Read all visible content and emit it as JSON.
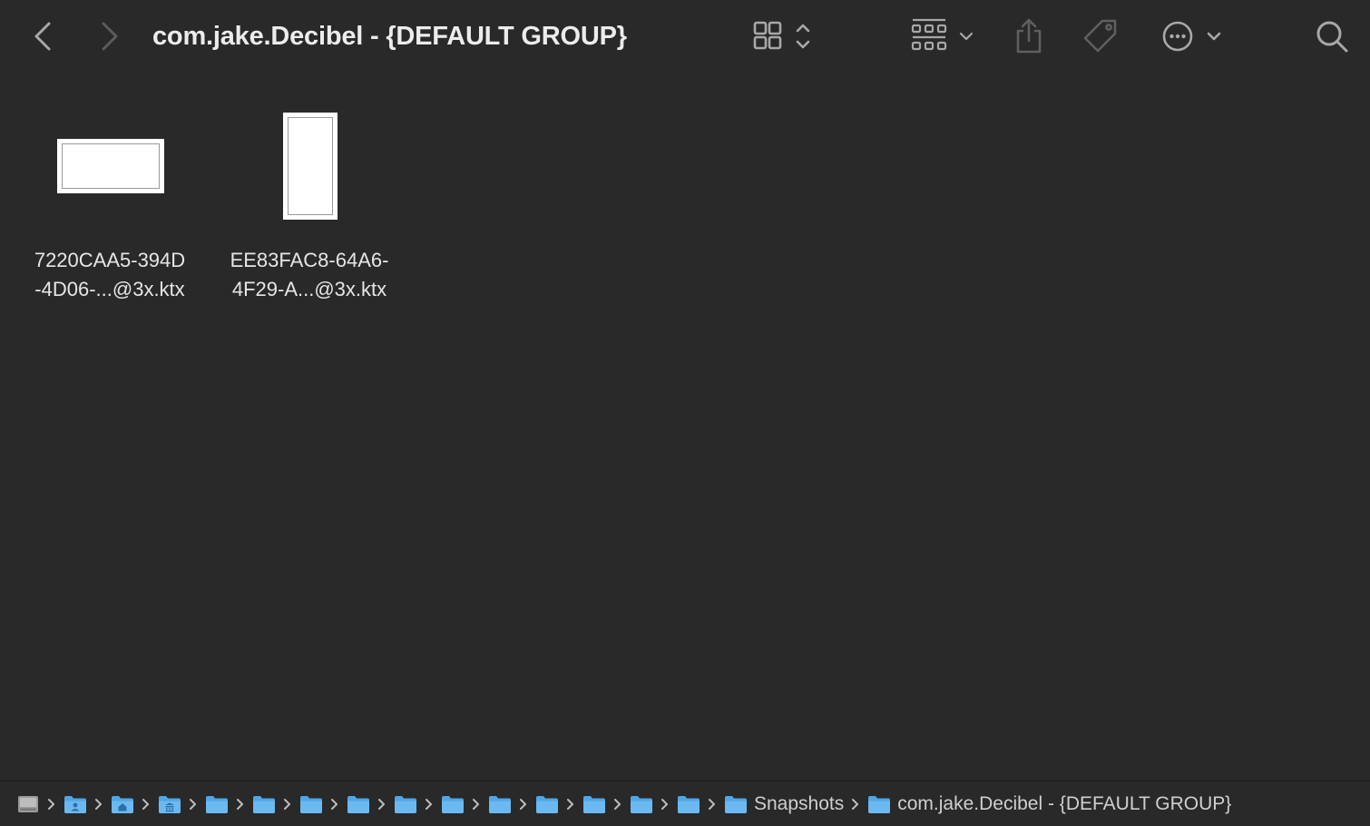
{
  "window": {
    "title": "com.jake.Decibel - {DEFAULT GROUP}"
  },
  "toolbar": {
    "back_icon": "chevron-left-icon",
    "forward_icon": "chevron-right-icon",
    "view_mode_icon": "icon-grid-icon",
    "group_by_icon": "group-grid-icon",
    "share_icon": "share-icon",
    "tags_icon": "tag-icon",
    "action_icon": "ellipsis-circle-icon",
    "search_icon": "search-icon"
  },
  "files": [
    {
      "name_line1": "7220CAA5-394D",
      "name_line2": "-4D06-...@3x.ktx",
      "orientation": "landscape"
    },
    {
      "name_line1": "EE83FAC8-64A6-",
      "name_line2": "4F29-A...@3x.ktx",
      "orientation": "portrait"
    }
  ],
  "pathbar": {
    "crumbs": [
      {
        "icon": "hard-drive-icon",
        "label": ""
      },
      {
        "icon": "user-folder-icon",
        "label": ""
      },
      {
        "icon": "home-folder-icon",
        "label": ""
      },
      {
        "icon": "library-folder-icon",
        "label": ""
      },
      {
        "icon": "folder-icon",
        "label": ""
      },
      {
        "icon": "folder-icon",
        "label": ""
      },
      {
        "icon": "folder-icon",
        "label": ""
      },
      {
        "icon": "folder-icon",
        "label": ""
      },
      {
        "icon": "folder-icon",
        "label": ""
      },
      {
        "icon": "folder-icon",
        "label": ""
      },
      {
        "icon": "folder-icon",
        "label": ""
      },
      {
        "icon": "folder-icon",
        "label": ""
      },
      {
        "icon": "folder-icon",
        "label": ""
      },
      {
        "icon": "folder-icon",
        "label": ""
      },
      {
        "icon": "folder-icon",
        "label": ""
      },
      {
        "icon": "folder-icon",
        "label": "Snapshots"
      },
      {
        "icon": "folder-icon",
        "label": "com.jake.Decibel - {DEFAULT GROUP}"
      }
    ]
  },
  "colors": {
    "background": "#282928",
    "folder_blue": "#4fa6e8",
    "text": "#e6e6e6",
    "icon_gray": "#9c9c9c"
  }
}
